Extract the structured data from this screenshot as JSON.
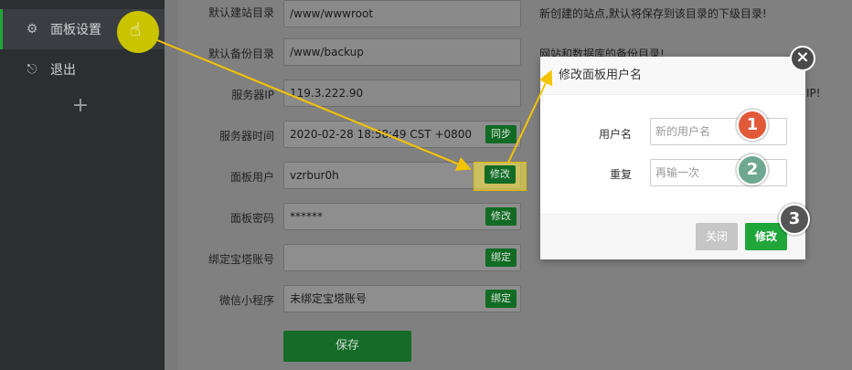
{
  "sidebar": {
    "items": [
      {
        "label": "面板设置",
        "icon": "gear-icon"
      },
      {
        "label": "退出",
        "icon": "logout-icon"
      }
    ],
    "add_icon": "plus-icon"
  },
  "settings": {
    "rows": [
      {
        "label": "默认建站目录",
        "value": "/www/wwwroot",
        "hint": "新创建的站点,默认将保存到该目录的下级目录!"
      },
      {
        "label": "默认备份目录",
        "value": "/www/backup",
        "hint": "网站和数据库的备份目录!"
      },
      {
        "label": "服务器IP",
        "value": "119.3.222.90",
        "hint": "IP!"
      },
      {
        "label": "服务器时间",
        "value": "2020-02-28 18:58:49 CST +0800",
        "button": "同步"
      },
      {
        "label": "面板用户",
        "value": "vzrbur0h",
        "button": "修改"
      },
      {
        "label": "面板密码",
        "value": "******",
        "button": "修改"
      },
      {
        "label": "绑定宝塔账号",
        "value": "",
        "button": "绑定"
      },
      {
        "label": "微信小程序",
        "value": "未绑定宝塔账号",
        "button": "绑定"
      }
    ],
    "save_label": "保存"
  },
  "dialog": {
    "title": "修改面板用户名",
    "username_label": "用户名",
    "username_placeholder": "新的用户名",
    "repeat_label": "重复",
    "repeat_placeholder": "再输一次",
    "cancel_label": "关闭",
    "confirm_label": "修改",
    "close_symbol": "×"
  },
  "steps": [
    "1",
    "2",
    "3"
  ],
  "colors": {
    "accent": "#20a53a",
    "badge1": "#e05a3a",
    "badge2": "#6fa892",
    "badge3": "#555555",
    "arrow": "#f5c400"
  }
}
